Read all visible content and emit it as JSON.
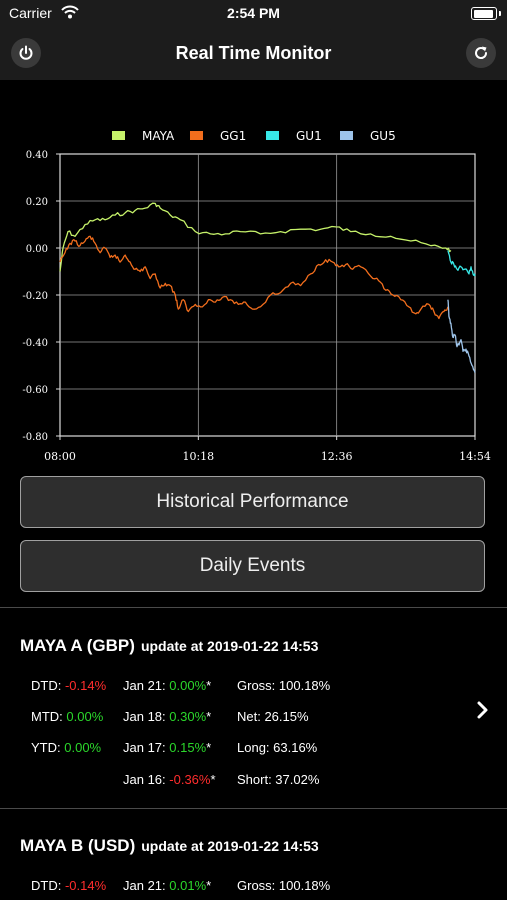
{
  "status_bar": {
    "carrier": "Carrier",
    "time": "2:54 PM",
    "battery_percent": 100
  },
  "header": {
    "title": "Real Time Monitor",
    "left_icon": "power-icon",
    "right_icon": "refresh-icon"
  },
  "chart_data": {
    "type": "line",
    "x_tick_labels": [
      "08:00",
      "10:18",
      "12:36",
      "14:54"
    ],
    "y_tick_labels": [
      "0.40",
      "0.20",
      "0.00",
      "-0.20",
      "-0.40",
      "-0.60",
      "-0.80"
    ],
    "ylim": [
      -0.8,
      0.4
    ],
    "x_range_minutes": [
      0,
      414
    ],
    "grid": true,
    "legend_position": "top",
    "series": [
      {
        "name": "MAYA",
        "color": "#c6f26a",
        "points": [
          [
            0,
            -0.1
          ],
          [
            3,
            0.0
          ],
          [
            8,
            0.07
          ],
          [
            15,
            0.05
          ],
          [
            25,
            0.1
          ],
          [
            35,
            0.12
          ],
          [
            45,
            0.12
          ],
          [
            55,
            0.14
          ],
          [
            65,
            0.15
          ],
          [
            75,
            0.16
          ],
          [
            85,
            0.17
          ],
          [
            95,
            0.19
          ],
          [
            100,
            0.17
          ],
          [
            110,
            0.14
          ],
          [
            120,
            0.12
          ],
          [
            135,
            0.07
          ],
          [
            150,
            0.06
          ],
          [
            165,
            0.06
          ],
          [
            180,
            0.07
          ],
          [
            200,
            0.06
          ],
          [
            220,
            0.07
          ],
          [
            240,
            0.08
          ],
          [
            260,
            0.08
          ],
          [
            275,
            0.09
          ],
          [
            290,
            0.07
          ],
          [
            310,
            0.06
          ],
          [
            330,
            0.05
          ],
          [
            350,
            0.03
          ],
          [
            370,
            0.01
          ],
          [
            385,
            0.0
          ],
          [
            390,
            -0.01
          ]
        ]
      },
      {
        "name": "GG1",
        "color": "#f26e1d",
        "points": [
          [
            0,
            -0.06
          ],
          [
            5,
            -0.02
          ],
          [
            10,
            0.02
          ],
          [
            15,
            0.03
          ],
          [
            20,
            0.01
          ],
          [
            25,
            0.03
          ],
          [
            30,
            0.05
          ],
          [
            35,
            0.02
          ],
          [
            40,
            -0.02
          ],
          [
            45,
            0.0
          ],
          [
            50,
            -0.04
          ],
          [
            55,
            -0.03
          ],
          [
            60,
            -0.06
          ],
          [
            65,
            -0.03
          ],
          [
            70,
            -0.06
          ],
          [
            75,
            -0.09
          ],
          [
            80,
            -0.1
          ],
          [
            85,
            -0.08
          ],
          [
            90,
            -0.13
          ],
          [
            95,
            -0.11
          ],
          [
            100,
            -0.17
          ],
          [
            105,
            -0.15
          ],
          [
            110,
            -0.16
          ],
          [
            115,
            -0.2
          ],
          [
            118,
            -0.26
          ],
          [
            123,
            -0.22
          ],
          [
            128,
            -0.27
          ],
          [
            135,
            -0.24
          ],
          [
            140,
            -0.25
          ],
          [
            148,
            -0.22
          ],
          [
            155,
            -0.23
          ],
          [
            162,
            -0.21
          ],
          [
            170,
            -0.22
          ],
          [
            178,
            -0.24
          ],
          [
            185,
            -0.23
          ],
          [
            192,
            -0.26
          ],
          [
            200,
            -0.25
          ],
          [
            210,
            -0.2
          ],
          [
            220,
            -0.19
          ],
          [
            230,
            -0.15
          ],
          [
            240,
            -0.16
          ],
          [
            250,
            -0.11
          ],
          [
            258,
            -0.07
          ],
          [
            265,
            -0.05
          ],
          [
            272,
            -0.06
          ],
          [
            278,
            -0.08
          ],
          [
            285,
            -0.07
          ],
          [
            292,
            -0.09
          ],
          [
            300,
            -0.08
          ],
          [
            310,
            -0.12
          ],
          [
            318,
            -0.14
          ],
          [
            325,
            -0.18
          ],
          [
            332,
            -0.2
          ],
          [
            340,
            -0.22
          ],
          [
            348,
            -0.25
          ],
          [
            355,
            -0.28
          ],
          [
            360,
            -0.26
          ],
          [
            368,
            -0.24
          ],
          [
            373,
            -0.27
          ],
          [
            378,
            -0.3
          ],
          [
            383,
            -0.27
          ],
          [
            387,
            -0.25
          ]
        ]
      },
      {
        "name": "GU1",
        "color": "#38e8e8",
        "points": [
          [
            387,
            -0.01
          ],
          [
            390,
            -0.06
          ],
          [
            393,
            -0.07
          ],
          [
            396,
            -0.09
          ],
          [
            400,
            -0.08
          ],
          [
            404,
            -0.09
          ],
          [
            408,
            -0.11
          ],
          [
            410,
            -0.08
          ],
          [
            412,
            -0.11
          ],
          [
            414,
            -0.12
          ]
        ]
      },
      {
        "name": "GU5",
        "color": "#9ec4ea",
        "points": [
          [
            387,
            -0.22
          ],
          [
            388,
            -0.29
          ],
          [
            390,
            -0.32
          ],
          [
            392,
            -0.38
          ],
          [
            394,
            -0.37
          ],
          [
            396,
            -0.42
          ],
          [
            400,
            -0.39
          ],
          [
            402,
            -0.44
          ],
          [
            405,
            -0.43
          ],
          [
            408,
            -0.46
          ],
          [
            411,
            -0.5
          ],
          [
            414,
            -0.53
          ]
        ]
      }
    ]
  },
  "buttons": {
    "historical": "Historical Performance",
    "daily_events": "Daily Events"
  },
  "funds": [
    {
      "title": "MAYA A (GBP)",
      "update": "update at 2019-01-22 14:53",
      "dtd_label": "DTD:",
      "dtd_value": "-0.14%",
      "mtd_label": "MTD:",
      "mtd_value": "0.00%",
      "ytd_label": "YTD:",
      "ytd_value": "0.00%",
      "daily": [
        {
          "date": "Jan 21:",
          "value": "0.00%",
          "mark": "*"
        },
        {
          "date": "Jan 18:",
          "value": "0.30%",
          "mark": "*"
        },
        {
          "date": "Jan 17:",
          "value": "0.15%",
          "mark": "*"
        },
        {
          "date": "Jan 16:",
          "value": "-0.36%",
          "mark": "*"
        }
      ],
      "stats": [
        "Gross: 100.18%",
        "Net: 26.15%",
        "Long: 63.16%",
        "Short: 37.02%"
      ]
    },
    {
      "title": "MAYA B (USD)",
      "update": "update at 2019-01-22 14:53",
      "dtd_label": "DTD:",
      "dtd_value": "-0.14%",
      "daily": [
        {
          "date": "Jan 21:",
          "value": "0.01%",
          "mark": "*"
        }
      ],
      "stats": [
        "Gross: 100.18%"
      ]
    }
  ]
}
